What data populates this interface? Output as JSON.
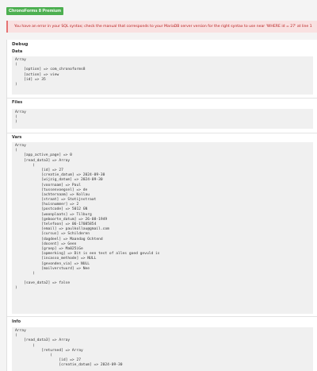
{
  "badge": "ChronoForms 8 Premium",
  "error": "You have an error in your SQL syntax; check the manual that corresponds to your MariaDB server version for the right syntax to use near 'WHERE id = 27' at line 1",
  "debug": {
    "title": "Debug",
    "sections": [
      {
        "label": "Data",
        "lines": [
          "Array",
          "(",
          "    [option] => com_chronoforms8",
          "    [action] => view",
          "    [id] => 35",
          ")"
        ]
      },
      {
        "label": "Files",
        "lines": [
          "Array",
          "(",
          ")"
        ]
      },
      {
        "label": "Vars",
        "lines": [
          "Array",
          "(",
          "    [app_active_page] => 0",
          "    [read_data3] => Array",
          "        (",
          "            [id] => 27",
          "            [creatie_datum] => 2024-09-30",
          "            [wijzig_datum] => 2024-09-30",
          "            [voornaam] => Paul",
          "            [tussenvoegsel] => de",
          "            [achternaam] => Kollau",
          "            [straat] => Stotijnstraat",
          "            [huisnummer] => 2",
          "            [postcode] => 5012 GN",
          "            [woonplaats] => Tilburg",
          "            [geboorte_datum] => 26-08-1949",
          "            [telefoon] => 06-17085854",
          "            [email] => paulkollau@gmail.com",
          "            [cursus] => Schilderen",
          "            [dagdeel] => Maandag Ochtend",
          "            [docent] => Geen",
          "            [groep] => Ma025iGe",
          "            [opmerking] => Dit is een test of alles goed gevuld is",
          "            [incasso_methode] => NULL",
          "            [gevonden_via] => NULL",
          "            [mailverstuurd] => Nee",
          "        )",
          "",
          "    [save_data2] => false",
          ")"
        ]
      },
      {
        "label": "Info",
        "lines": [
          "Array",
          "(",
          "    [read_data3] => Array",
          "        (",
          "            [returned] => Array",
          "                (",
          "                    [id] => 27",
          "                    [creatie_datum] => 2024-09-30"
        ]
      }
    ]
  }
}
